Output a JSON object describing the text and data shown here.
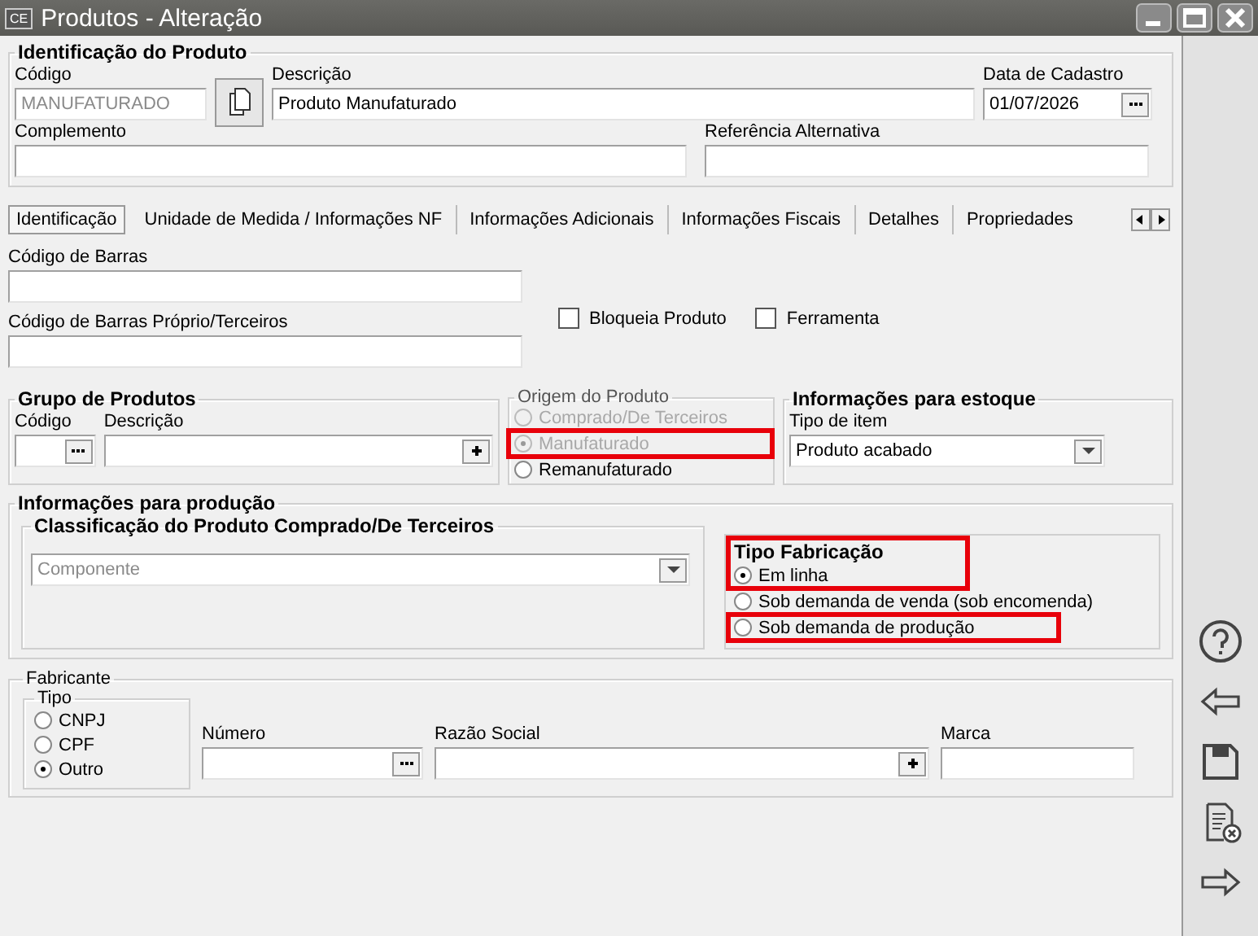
{
  "window": {
    "logo": "CE",
    "title": "Produtos - Alteração"
  },
  "product": {
    "title": "Identificação do Produto",
    "code": {
      "label": "Código",
      "value": "MANUFATURADO",
      "disabled": true
    },
    "description": {
      "label": "Descrição",
      "value": "Produto Manufaturado"
    },
    "date": {
      "label": "Data de Cadastro",
      "value": "01/07/2026"
    },
    "complement": {
      "label": "Complemento"
    },
    "alt_reference": {
      "label": "Referência Alternativa"
    }
  },
  "tabs": [
    {
      "label": "Identificação",
      "selected": true
    },
    {
      "label": "Unidade de Medida / Informações NF",
      "selected": false
    },
    {
      "label": "Informações Adicionais",
      "selected": false
    },
    {
      "label": "Informações Fiscais",
      "selected": false
    },
    {
      "label": "Detalhes",
      "selected": false
    },
    {
      "label": "Propriedades",
      "selected": false
    }
  ],
  "barcode": {
    "label": "Código de Barras"
  },
  "barcode_own": {
    "label": "Código de Barras Próprio/Terceiros"
  },
  "checkboxes": [
    {
      "label": "Bloqueia Produto",
      "checked": false
    },
    {
      "label": "Ferramenta",
      "checked": false
    }
  ],
  "product_group": {
    "title": "Grupo de Produtos",
    "code_label": "Código",
    "description_label": "Descrição"
  },
  "origin": {
    "title": "Origem do Produto",
    "options": [
      {
        "label": "Comprado/De Terceiros",
        "selected": false,
        "disabled": true,
        "highlighted": false
      },
      {
        "label": "Manufaturado",
        "selected": true,
        "disabled": true,
        "highlighted": true
      },
      {
        "label": "Remanufaturado",
        "selected": false,
        "disabled": false,
        "highlighted": false
      }
    ]
  },
  "stock": {
    "title": "Informações para estoque",
    "label": "Tipo de item",
    "value": "Produto acabado"
  },
  "production": {
    "title": "Informações para produção",
    "classification": {
      "title": "Classificação do Produto Comprado/De Terceiros",
      "value": "Componente",
      "disabled": true
    },
    "fabrication": {
      "title": "Tipo Fabricação",
      "title_highlighted": true,
      "options": [
        {
          "label": "Em linha",
          "selected": true,
          "highlighted": true
        },
        {
          "label": "Sob demanda de venda (sob encomenda)",
          "selected": false,
          "highlighted": false
        },
        {
          "label": "Sob demanda de produção",
          "selected": false,
          "highlighted": true
        }
      ]
    }
  },
  "manufacturer": {
    "title": "Fabricante",
    "type_title": "Tipo",
    "types": [
      {
        "label": "CNPJ",
        "selected": false
      },
      {
        "label": "CPF",
        "selected": false
      },
      {
        "label": "Outro",
        "selected": true
      }
    ],
    "number_label": "Número",
    "name_label": "Razão Social",
    "brand_label": "Marca"
  },
  "toolbar": [
    {
      "kind": "help"
    },
    {
      "kind": "back"
    },
    {
      "kind": "save"
    },
    {
      "kind": "cancel"
    },
    {
      "kind": "forward"
    }
  ]
}
